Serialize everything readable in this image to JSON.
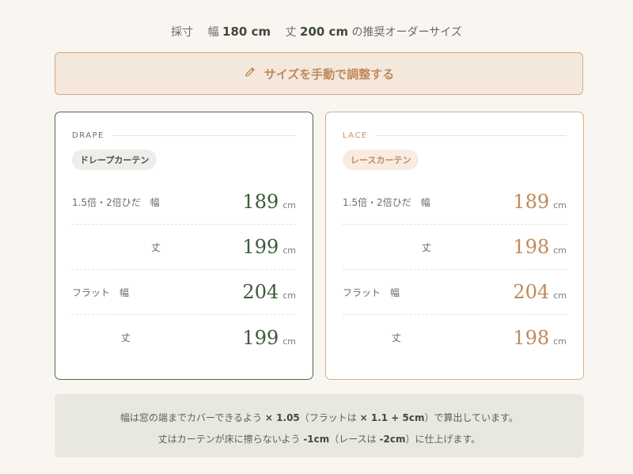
{
  "summary": {
    "prefix": "採寸",
    "width_label": "幅",
    "width_value": "180 cm",
    "height_label": "丈",
    "height_value": "200 cm",
    "suffix": "の推奨オーダーサイズ"
  },
  "adjust_button": {
    "label": "サイズを手動で調整する",
    "icon": "pencil-icon"
  },
  "cards": [
    {
      "code": "DRAPE",
      "chip": "ドレープカーテン",
      "rows": [
        {
          "category": "1.5倍・2倍ひだ",
          "dimension": "幅",
          "value": "189",
          "unit": "cm"
        },
        {
          "category": "",
          "dimension": "丈",
          "value": "199",
          "unit": "cm"
        },
        {
          "category": "フラット",
          "dimension": "幅",
          "value": "204",
          "unit": "cm"
        },
        {
          "category": "",
          "dimension": "丈",
          "value": "199",
          "unit": "cm"
        }
      ]
    },
    {
      "code": "LACE",
      "chip": "レースカーテン",
      "rows": [
        {
          "category": "1.5倍・2倍ひだ",
          "dimension": "幅",
          "value": "189",
          "unit": "cm"
        },
        {
          "category": "",
          "dimension": "丈",
          "value": "198",
          "unit": "cm"
        },
        {
          "category": "フラット",
          "dimension": "幅",
          "value": "204",
          "unit": "cm"
        },
        {
          "category": "",
          "dimension": "丈",
          "value": "198",
          "unit": "cm"
        }
      ]
    }
  ],
  "note": {
    "line1_a": "幅は窓の端までカバーできるよう",
    "line1_b": "× 1.05",
    "line1_c": "（フラットは",
    "line1_d": "× 1.1 + 5cm",
    "line1_e": "）で算出しています。",
    "line2_a": "丈はカーテンが床に擦らないよう",
    "line2_b": "-1cm",
    "line2_c": "（レースは",
    "line2_d": "-2cm",
    "line2_e": "）に仕上げます。"
  },
  "colors": {
    "background": "#f9f6f2",
    "drape_accent": "#3f5a3c",
    "lace_accent": "#c08a5c",
    "button_bg": "#f4e8dc",
    "note_bg": "#e8e8e1"
  }
}
